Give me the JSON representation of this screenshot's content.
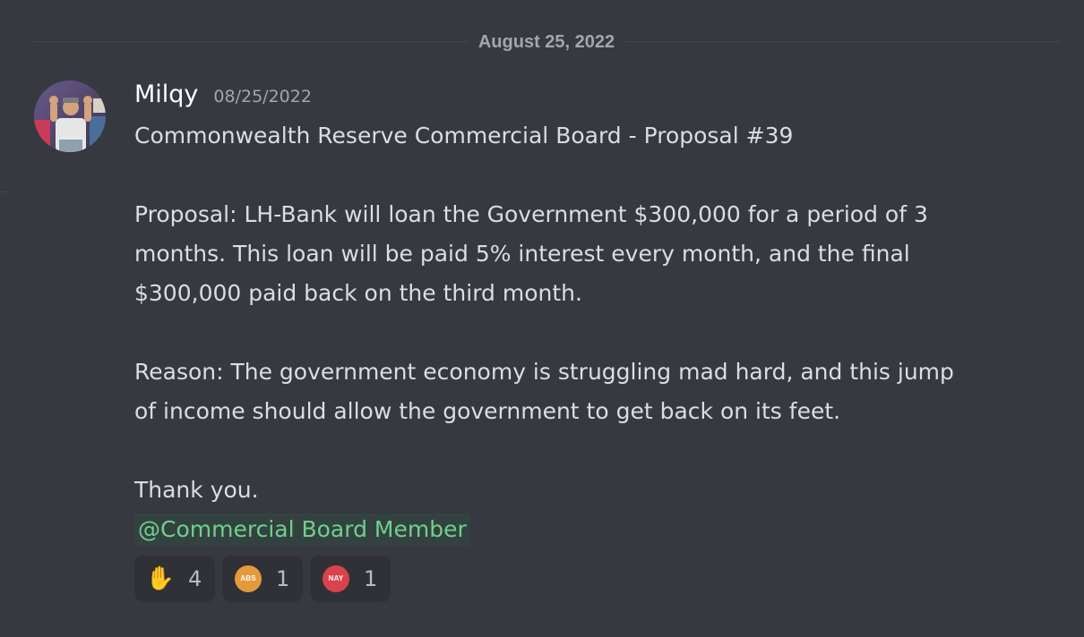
{
  "date_divider": {
    "label": "August 25, 2022"
  },
  "message": {
    "author": "Milqy",
    "timestamp": "08/25/2022",
    "lines": {
      "title": "Commonwealth Reserve Commercial Board - Proposal #39",
      "proposal_1": "Proposal: LH-Bank will loan the Government $300,000 for a period of 3",
      "proposal_2": "months. This loan will be paid 5% interest every month, and the final",
      "proposal_3": "$300,000 paid back on the third month.",
      "reason_1": "Reason: The government economy is struggling mad hard, and this jump",
      "reason_2": "of income should allow the government to get back on its feet.",
      "thanks": "Thank you."
    },
    "mention": "@Commercial Board Member",
    "reactions": [
      {
        "emoji": "raised-hand-icon",
        "glyph": "✋",
        "count": "4"
      },
      {
        "emoji": "abs-icon",
        "badge": "ABS",
        "color": "#e39a3b",
        "count": "1"
      },
      {
        "emoji": "nay-icon",
        "badge": "NAY",
        "color": "#d9434b",
        "count": "1"
      }
    ]
  },
  "colors": {
    "background": "#36393f",
    "mention_text": "#6fd08b",
    "mention_bg": "#334240",
    "reaction_bg": "#2f3136"
  }
}
